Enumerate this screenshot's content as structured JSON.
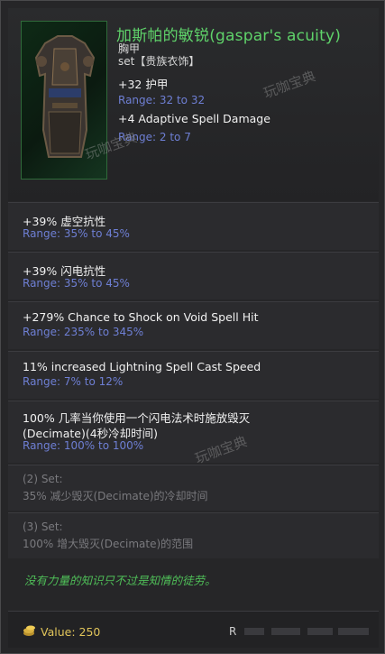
{
  "item": {
    "name": "加斯帕的敏锐(gaspar's acuity)",
    "slot": "胸甲",
    "set_line": "set【贵族衣饰】",
    "implicits": [
      {
        "stat": "+32 护甲",
        "range": "Range: 32 to 32"
      },
      {
        "stat": "+4 Adaptive Spell Damage",
        "range": "Range: 2 to 7"
      }
    ]
  },
  "affixes": [
    {
      "stat": "+39% 虚空抗性",
      "range": "Range: 35% to 45%"
    },
    {
      "stat": "+39% 闪电抗性",
      "range": "Range: 35% to 45%"
    },
    {
      "stat": "+279% Chance to Shock on Void Spell Hit",
      "range": "Range: 235% to 345%"
    },
    {
      "stat": "11% increased Lightning Spell Cast Speed",
      "range": "Range: 7% to 12%"
    },
    {
      "stat_line1": "100% 几率当你使用一个闪电法术时施放毁灭",
      "stat_line2": "(Decimate)(4秒冷却时间)",
      "range": "Range: 100% to 100%"
    }
  ],
  "set_bonuses": [
    {
      "label": "(2) Set:",
      "text": "35% 减少毁灭(Decimate)的冷却时间"
    },
    {
      "label": "(3) Set:",
      "text": "100% 增大毁灭(Decimate)的范围"
    }
  ],
  "flavor_text": "没有力量的知识只不过是知情的徒劳。",
  "footer": {
    "value": "Value: 250",
    "r_letter": "R"
  },
  "watermark": {
    "text": "玩咖宝典"
  },
  "colors": {
    "name": "#5fd36a",
    "range": "#6e7fd4",
    "flavor": "#4fbf58",
    "value": "#e0c45a",
    "dim": "#7a7a7e"
  }
}
